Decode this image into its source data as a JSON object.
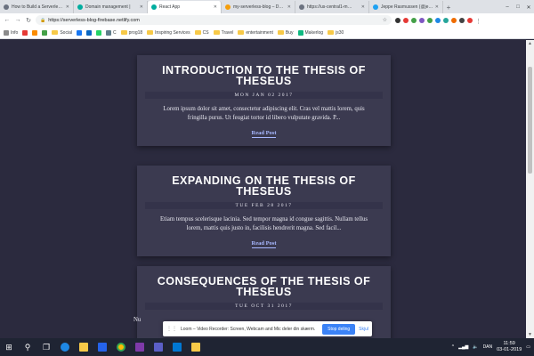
{
  "browser": {
    "tabs": [
      {
        "label": "How to Build a Serverle…",
        "color": "#6b7280",
        "active": false
      },
      {
        "label": "Domain management |",
        "color": "#00ad9f",
        "active": false
      },
      {
        "label": "React App",
        "color": "#00ad9f",
        "active": true
      },
      {
        "label": "my-serverless-blog – D…",
        "color": "#f59e0b",
        "active": false
      },
      {
        "label": "https://us-central1-m…",
        "color": "#6b7280",
        "active": false
      },
      {
        "label": "Jeppe Rasmussen (@je…",
        "color": "#1da1f2",
        "active": false
      }
    ],
    "new_tab": "+",
    "url": "https://serverless-blog-firebase.netlify.com",
    "bookmarks": [
      {
        "label": "Info",
        "color": "#8b8b8b",
        "folder": false
      },
      {
        "label": "",
        "color": "#e53935",
        "folder": false
      },
      {
        "label": "",
        "color": "#fb8c00",
        "folder": false
      },
      {
        "label": "",
        "color": "#43a047",
        "folder": false
      },
      {
        "label": "Social",
        "color": "",
        "folder": true
      },
      {
        "label": "",
        "color": "#1877f2",
        "folder": false
      },
      {
        "label": "",
        "color": "#0a66c2",
        "folder": false
      },
      {
        "label": "",
        "color": "#25d366",
        "folder": false
      },
      {
        "label": "C",
        "color": "#607d8b",
        "folder": false
      },
      {
        "label": "prog18",
        "color": "",
        "folder": true
      },
      {
        "label": "Inspiring Services",
        "color": "",
        "folder": true
      },
      {
        "label": "CS",
        "color": "",
        "folder": true
      },
      {
        "label": "Travel",
        "color": "",
        "folder": true
      },
      {
        "label": "entertainment",
        "color": "",
        "folder": true
      },
      {
        "label": "Buy",
        "color": "",
        "folder": true
      },
      {
        "label": "Makerlog",
        "color": "#10b981",
        "folder": false
      },
      {
        "label": "js30",
        "color": "",
        "folder": true
      }
    ]
  },
  "posts": [
    {
      "title": "Introduction to the Thesis of Theseus",
      "date": "MON JAN 02 2017",
      "excerpt": "Lorem ipsum dolor sit amet, consectetur adipiscing elit. Cras vel mattis lorem, quis fringilla purus. Ut feugiat tortor id libero vulputate gravida. P...",
      "read_more": "Read Post"
    },
    {
      "title": "Expanding on the Thesis of Theseus",
      "date": "TUE FEB 28 2017",
      "excerpt": "Etiam tempus scelerisque lacinia. Sed tempor magna id congue sagittis. Nullam tellus lorem, mattis quis justo in, facilisis hendrerit magna. Sed facil...",
      "read_more": "Read Post"
    },
    {
      "title": "Consequences of the Thesis of Theseus",
      "date": "TUE OCT 31 2017",
      "excerpt": "Nu",
      "read_more": ""
    }
  ],
  "loom": {
    "text": "Loom – Video Recorder: Screen, Webcam and Mic deler din skærm.",
    "stop_label": "Stop deling",
    "hide_label": "Skjul"
  },
  "taskbar": {
    "language": "DAN",
    "time": "11:59",
    "date": "03-01-2019"
  }
}
